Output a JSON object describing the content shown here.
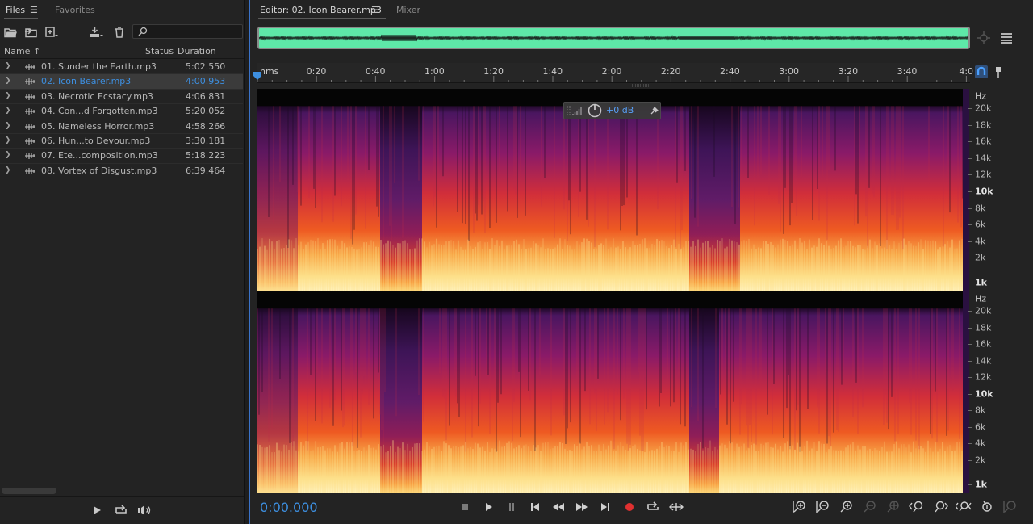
{
  "files_panel": {
    "tabs": [
      {
        "label": "Files",
        "active": true
      },
      {
        "label": "Favorites",
        "active": false
      }
    ],
    "menu_glyph": "☰",
    "search": {
      "value": "",
      "placeholder": ""
    },
    "columns": {
      "name": "Name",
      "sort_indicator": "↑",
      "status": "Status",
      "duration": "Duration"
    },
    "files": [
      {
        "name": "01. Sunder the Earth.mp3",
        "duration": "5:02.550",
        "selected": false
      },
      {
        "name": "02. Icon Bearer.mp3",
        "duration": "4:00.953",
        "selected": true
      },
      {
        "name": "03. Necrotic Ecstacy.mp3",
        "duration": "4:06.831",
        "selected": false
      },
      {
        "name": "04. Con...d Forgotten.mp3",
        "duration": "5:20.052",
        "selected": false
      },
      {
        "name": "05. Nameless Horror.mp3",
        "duration": "4:58.266",
        "selected": false
      },
      {
        "name": "06. Hun...to Devour.mp3",
        "duration": "3:30.181",
        "selected": false
      },
      {
        "name": "07. Ete...composition.mp3",
        "duration": "5:18.223",
        "selected": false
      },
      {
        "name": "08. Vortex of Disgust.mp3",
        "duration": "6:39.464",
        "selected": false
      }
    ]
  },
  "editor": {
    "tabs": [
      {
        "label": "Editor: 02. Icon Bearer.mp3",
        "active": true
      },
      {
        "label": "Mixer",
        "active": false
      }
    ],
    "menu_glyph": "☰",
    "ruler": {
      "unit_label": "hms",
      "ticks": [
        "0:20",
        "0:40",
        "1:00",
        "1:20",
        "1:40",
        "2:00",
        "2:20",
        "2:40",
        "3:00",
        "3:20",
        "3:40",
        "4:0"
      ]
    },
    "hud": {
      "gain": "+0 dB"
    },
    "hz_scale": {
      "title": "Hz",
      "labels": [
        "20k",
        "18k",
        "16k",
        "14k",
        "12k",
        "10k",
        "8k",
        "6k",
        "4k",
        "2k",
        "1k"
      ]
    },
    "time_display": "0:00.000"
  },
  "colors": {
    "accent_blue": "#3d8fe0",
    "overview_green": "#5ee8a8",
    "spectrum_low": "#fde08a",
    "spectrum_mid": "#e83a2a",
    "spectrum_high": "#5a1a6a",
    "record_red": "#e03030"
  }
}
